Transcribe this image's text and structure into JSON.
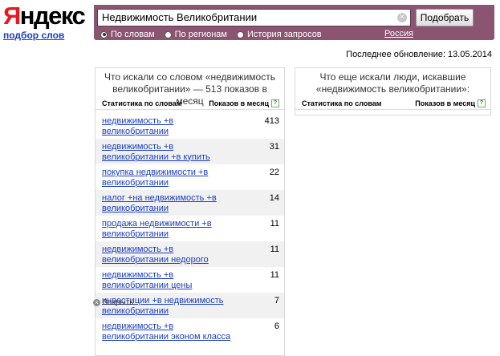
{
  "logo": {
    "first": "Я",
    "rest": "ндекс"
  },
  "subtitle": "подбор слов",
  "search": {
    "value": "Недвижимость Великобритании",
    "button": "Подобрать",
    "options": [
      {
        "label": "По словам",
        "checked": true
      },
      {
        "label": "По регионам",
        "checked": false
      },
      {
        "label": "История запросов",
        "checked": false
      }
    ],
    "region": "Россия"
  },
  "updated": "Последнее обновление: 13.05.2014",
  "left_panel": {
    "heading": "Что искали со словом «недвижимость великобритании» — 513 показов в месяц",
    "col_words": "Статистика по словам",
    "col_counts": "Показов в месяц",
    "rows": [
      {
        "kw": "недвижимость +в великобритании",
        "count": "413"
      },
      {
        "kw": "недвижимость +в великобритании +в купить",
        "count": "31"
      },
      {
        "kw": "покупка недвижимости +в великобритании",
        "count": "22"
      },
      {
        "kw": "налог +на недвижимость +в великобритании",
        "count": "14"
      },
      {
        "kw": "продажа недвижимости +в великобритании",
        "count": "11"
      },
      {
        "kw": "недвижимость +в великобритании недорого",
        "count": "11"
      },
      {
        "kw": "недвижимость +в великобритании цены",
        "count": "11"
      },
      {
        "kw": "инвестиции +в недвижимость великобритании",
        "count": "7"
      },
      {
        "kw": "недвижимость +в великобритании эконом класса",
        "count": "6"
      }
    ]
  },
  "right_panel": {
    "heading": "Что еще искали люди, искавшие «недвижимость великобритании»:",
    "col_words": "Статистика по словам",
    "col_counts": "Показов в месяц"
  },
  "close_tip": "Закрыть",
  "help_glyph": "?"
}
